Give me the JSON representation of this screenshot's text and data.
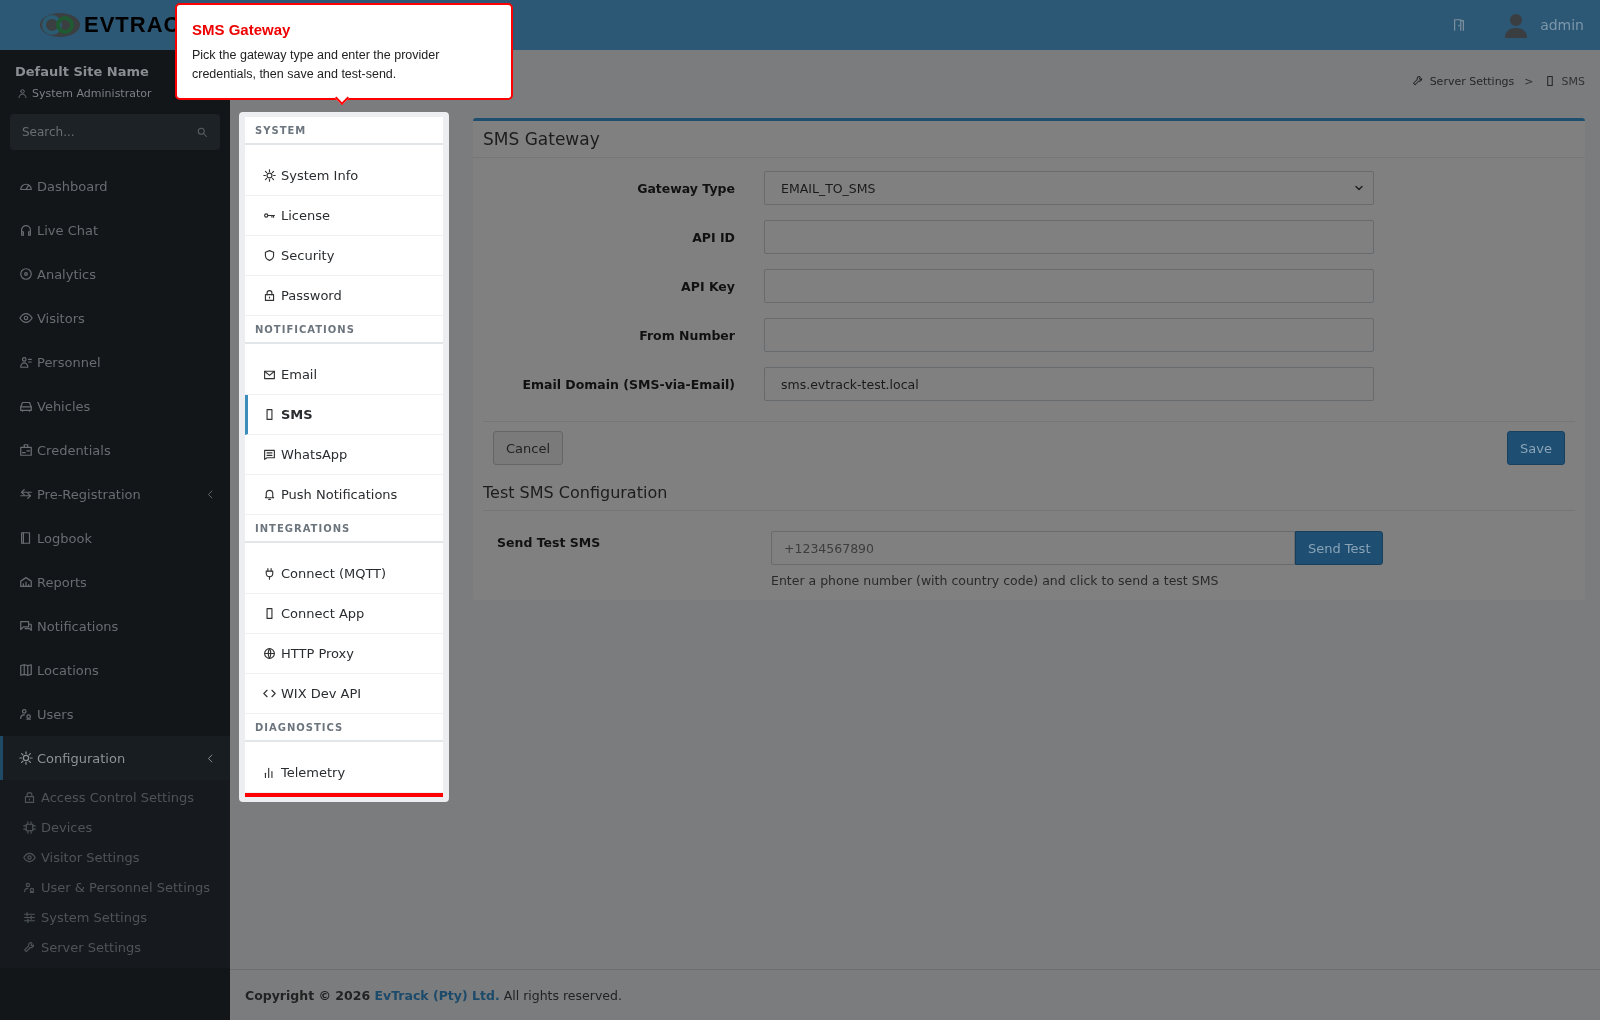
{
  "header": {
    "logo_text": "EVTRAC",
    "user": "admin"
  },
  "sidebar": {
    "site_name": "Default Site Name",
    "role": "System Administrator",
    "search": {
      "placeholder": "Search..."
    },
    "items": [
      {
        "label": "Dashboard",
        "expandable": false,
        "selected": false
      },
      {
        "label": "Live Chat",
        "expandable": false,
        "selected": false
      },
      {
        "label": "Analytics",
        "expandable": false,
        "selected": false
      },
      {
        "label": "Visitors",
        "expandable": false,
        "selected": false
      },
      {
        "label": "Personnel",
        "expandable": false,
        "selected": false
      },
      {
        "label": "Vehicles",
        "expandable": false,
        "selected": false
      },
      {
        "label": "Credentials",
        "expandable": false,
        "selected": false
      },
      {
        "label": "Pre-Registration",
        "expandable": true,
        "selected": false
      },
      {
        "label": "Logbook",
        "expandable": false,
        "selected": false
      },
      {
        "label": "Reports",
        "expandable": false,
        "selected": false
      },
      {
        "label": "Notifications",
        "expandable": false,
        "selected": false
      },
      {
        "label": "Locations",
        "expandable": false,
        "selected": false
      },
      {
        "label": "Users",
        "expandable": false,
        "selected": false
      },
      {
        "label": "Configuration",
        "expandable": true,
        "selected": true,
        "children": [
          {
            "label": "Access Control Settings",
            "selected": false
          },
          {
            "label": "Devices",
            "selected": false
          },
          {
            "label": "Visitor Settings",
            "selected": false
          },
          {
            "label": "User & Personnel Settings",
            "selected": false
          },
          {
            "label": "System Settings",
            "selected": false
          },
          {
            "label": "Server Settings",
            "selected": false
          }
        ]
      }
    ]
  },
  "tour_tooltip": {
    "title": "SMS Gateway",
    "text": "Pick the gateway type and enter the provider credentials, then save and test-send."
  },
  "breadcrumb": {
    "separator": ">",
    "items": [
      "Server Settings",
      "SMS"
    ]
  },
  "settings_menu": [
    {
      "heading": "SYSTEM",
      "items": [
        {
          "label": "System Info",
          "selected": false
        },
        {
          "label": "License",
          "selected": false
        },
        {
          "label": "Security",
          "selected": false
        },
        {
          "label": "Password",
          "selected": false
        }
      ]
    },
    {
      "heading": "NOTIFICATIONS",
      "items": [
        {
          "label": "Email",
          "selected": false
        },
        {
          "label": "SMS",
          "selected": true
        },
        {
          "label": "WhatsApp",
          "selected": false
        },
        {
          "label": "Push Notifications",
          "selected": false
        }
      ]
    },
    {
      "heading": "INTEGRATIONS",
      "items": [
        {
          "label": "Connect (MQTT)",
          "selected": false
        },
        {
          "label": "Connect App",
          "selected": false
        },
        {
          "label": "HTTP Proxy",
          "selected": false
        },
        {
          "label": "WIX Dev API",
          "selected": false
        }
      ]
    },
    {
      "heading": "DIAGNOSTICS",
      "items": [
        {
          "label": "Telemetry",
          "selected": false
        }
      ]
    }
  ],
  "form": {
    "title": "SMS Gateway",
    "fields": [
      {
        "label": "Gateway Type",
        "kind": "select",
        "value": "EMAIL_TO_SMS"
      },
      {
        "label": "API ID",
        "kind": "input"
      },
      {
        "label": "API Key",
        "kind": "input"
      },
      {
        "label": "From Number",
        "kind": "input"
      },
      {
        "label": "Email Domain (SMS-via-Email)",
        "kind": "input",
        "value": "sms.evtrack-test.local"
      }
    ],
    "cancel": "Cancel",
    "save": "Save"
  },
  "test": {
    "title": "Test SMS Configuration",
    "label": "Send Test SMS",
    "placeholder": "+1234567890",
    "button": "Send Test",
    "help": "Enter a phone number (with country code) and click to send a test SMS"
  },
  "footer": {
    "prefix": "Copyright © 2026",
    "link": "EvTrack (Pty) Ltd.",
    "suffix": "All rights reserved."
  }
}
